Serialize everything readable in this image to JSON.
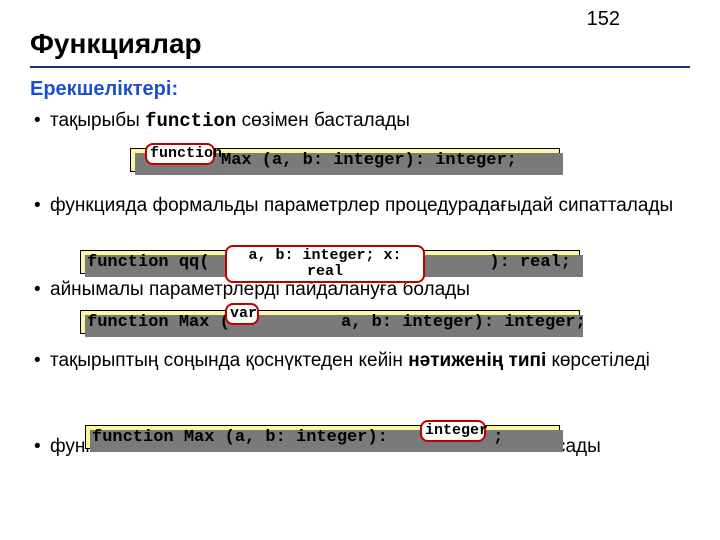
{
  "page_number": "152",
  "title": "Функциялар",
  "subtitle": "Ерекшеліктері:",
  "bullets": {
    "b1_pre": "тақырыбы ",
    "b1_kw": "function",
    "b1_post": "  сөзімен басталады",
    "b2": "функцияда формальды параметрлер процедурадағыдай сипатталады",
    "b3": "айнымалы параметрлерді пайдалануға болады",
    "b4_pre": "тақырыптың соңында қоснүктеден кейін ",
    "b4_bold": "нәтиженің типі",
    "b4_post": " көрсетіледі",
    "b5_pre": "функ",
    "b5_post": "ласады"
  },
  "code1": {
    "callout": "function",
    "rest": " Max (a, b: integer): integer;"
  },
  "code2": {
    "left": "function qq( ",
    "callout": "a, b: integer; x: real",
    "right": "): real;"
  },
  "code3": {
    "left": "function Max (",
    "callout": "var",
    "right": " a, b: integer): integer;"
  },
  "code4": {
    "left": "function Max (a, b: integer):",
    "callout": "integer",
    "right": ";"
  }
}
